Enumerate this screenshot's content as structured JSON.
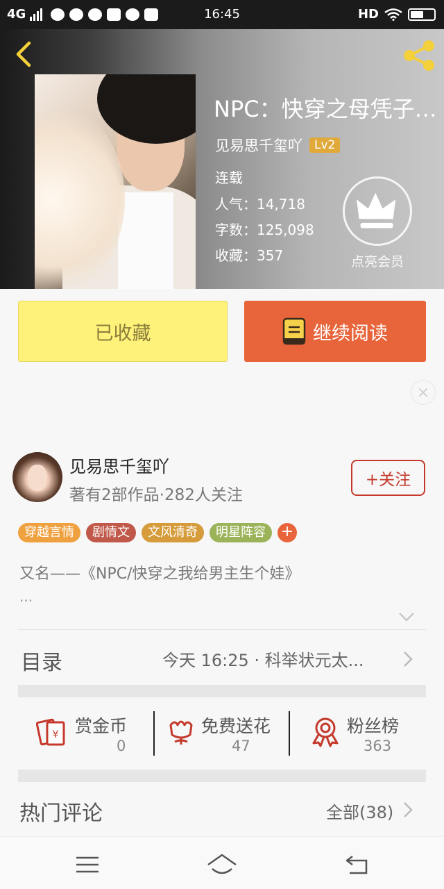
{
  "status_bar": {
    "network": "4G",
    "time": "16:45",
    "hd": "HD"
  },
  "book": {
    "title": "NPC：快穿之母凭子…",
    "author": "见易思千玺吖",
    "level": "Lv2",
    "status": "连载",
    "popularity_label": "人气：",
    "popularity": "14,718",
    "words_label": "字数：",
    "words": "125,098",
    "favorites_label": "收藏：",
    "favorites": "357",
    "vip_label": "点亮会员"
  },
  "actions": {
    "collected_label": "已收藏",
    "continue_label": "继续阅读"
  },
  "author": {
    "name": "见易思千玺吖",
    "summary": "著有2部作品·282人关注",
    "follow_label": "+关注"
  },
  "tags": [
    {
      "label": "穿越言情",
      "color": "#f0a13f"
    },
    {
      "label": "剧情文",
      "color": "#c0594a"
    },
    {
      "label": "文风清奇",
      "color": "#d69b3a"
    },
    {
      "label": "明星阵容",
      "color": "#9bb45a"
    }
  ],
  "tag_more": "+",
  "description": {
    "text": "又名——《NPC/快穿之我给男主生个娃》",
    "more": "..."
  },
  "toc": {
    "label": "目录",
    "latest": "今天 16:25 · 科举状元太..."
  },
  "stats": [
    {
      "label": "赏金币",
      "value": "0",
      "icon": "coin-envelope-icon"
    },
    {
      "label": "免费送花",
      "value": "47",
      "icon": "flower-icon"
    },
    {
      "label": "粉丝榜",
      "value": "363",
      "icon": "medal-icon"
    }
  ],
  "comments": {
    "label": "热门评论",
    "all_label": "全部(38)"
  },
  "colors": {
    "accent": "#e8643a",
    "collect_bg": "#fef27a",
    "follow_red": "#c4392c",
    "level_badge": "#e0a93a"
  }
}
